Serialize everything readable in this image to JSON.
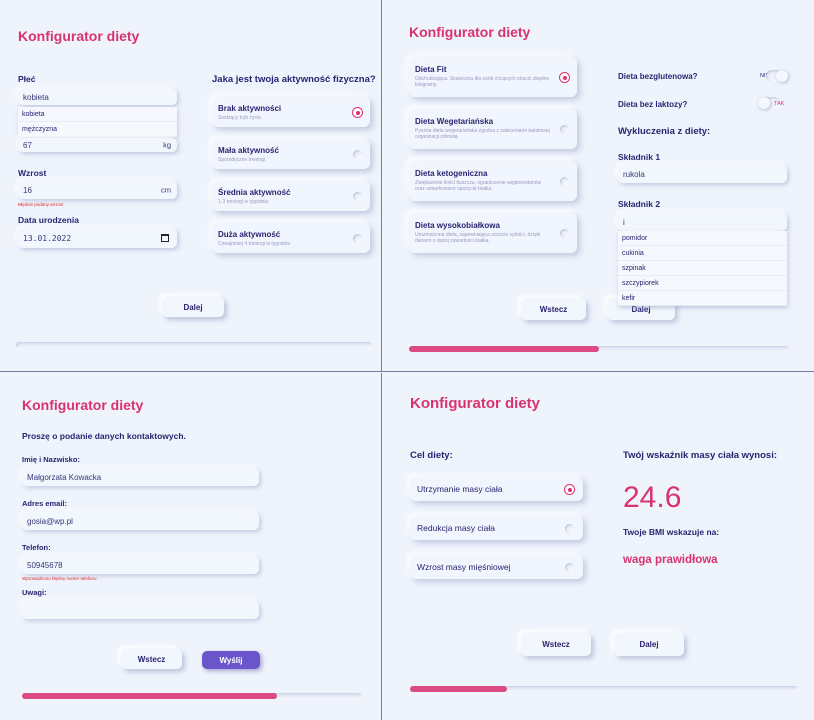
{
  "app_title": "Konfigurator diety",
  "step1": {
    "sex_label": "Płeć",
    "sex_value": "kobieta",
    "sex_options": [
      "kobieta",
      "mężczyzna"
    ],
    "weight_value": "67",
    "weight_unit": "kg",
    "height_label": "Wzrost",
    "height_value": "16",
    "height_unit": "cm",
    "height_error": "Błędnie podany wzrost",
    "birth_label": "Data urodzenia",
    "birth_value": "13.01.2022",
    "activity_label": "Jaka jest twoja aktywność fizyczna?",
    "activities": [
      {
        "title": "Brak aktywności",
        "desc": "Siedzący tryb życia",
        "selected": true
      },
      {
        "title": "Mała aktywność",
        "desc": "Sporadyczne treningi",
        "selected": false
      },
      {
        "title": "Średnia aktywność",
        "desc": "1-3 treningi w tygodniu",
        "selected": false
      },
      {
        "title": "Duża aktywność",
        "desc": "Conajmniej 4 treningi w tygodniu",
        "selected": false
      }
    ],
    "next_label": "Dalej",
    "progress": 0
  },
  "step2": {
    "diets": [
      {
        "title": "Dieta Fit",
        "desc": "Odchudzająca. Skuteczna dla osób chcących stracić zbędne kilogramy.",
        "selected": true
      },
      {
        "title": "Dieta Wegetariańska",
        "desc": "Pyszna dieta wegetariańska zgodna z zaleceniami światowej organizacji zdrowia.",
        "selected": false
      },
      {
        "title": "Dieta ketogeniczna",
        "desc": "Zwiększenie ilości tłuszczu, ograniczenie węglowodanów oraz umiarkowane spożycie białka.",
        "selected": false
      },
      {
        "title": "Dieta wysokobiałkowa",
        "desc": "Urozmaicona dieta, zapewniająca uczucie sytości, dzięki daniom o dużej zawartości białka.",
        "selected": false
      }
    ],
    "gluten_label": "Dieta bezglutenowa?",
    "gluten_state": "NIE",
    "lactose_label": "Dieta bez laktozy?",
    "lactose_state": "TAK",
    "exclusions_label": "Wykluczenia z diety:",
    "ing1_label": "Składnik 1",
    "ing1_value": "rukola",
    "ing2_label": "Składnik 2",
    "ing2_value": "i",
    "ing2_options": [
      "pomidor",
      "cukinia",
      "szpinak",
      "szczypiorek",
      "kefir"
    ],
    "back_label": "Wstecz",
    "next_label": "Dalej",
    "progress": 0.5
  },
  "step3": {
    "prompt": "Proszę o podanie danych kontaktowych.",
    "name_label": "Imię i Nazwisko:",
    "name_value": "Małgorzata Kowacka",
    "email_label": "Adres email:",
    "email_value": "gosia@wp.pl",
    "phone_label": "Telefon:",
    "phone_value": "50945678",
    "phone_error": "Wprowadzono błędny numer telefonu",
    "notes_label": "Uwagi:",
    "notes_value": "",
    "back_label": "Wstecz",
    "send_label": "Wyślij",
    "progress": 0.75
  },
  "step4": {
    "goal_label": "Cel diety:",
    "goals": [
      {
        "title": "Utrzymanie masy ciała",
        "selected": true
      },
      {
        "title": "Redukcja masy ciała",
        "selected": false
      },
      {
        "title": "Wzrost masy mięśniowej",
        "selected": false
      }
    ],
    "bmi_label": "Twój wskaźnik masy ciała wynosi:",
    "bmi_value": "24.6",
    "bmi_verdict_label": "Twoje BMI wskazuje na:",
    "bmi_verdict": "waga prawidłowa",
    "back_label": "Wstecz",
    "next_label": "Dalej",
    "progress": 0.25
  },
  "colors": {
    "accent": "#d9336e",
    "primary": "#6a55cc",
    "text": "#2a2470",
    "background": "#eef3fc"
  }
}
